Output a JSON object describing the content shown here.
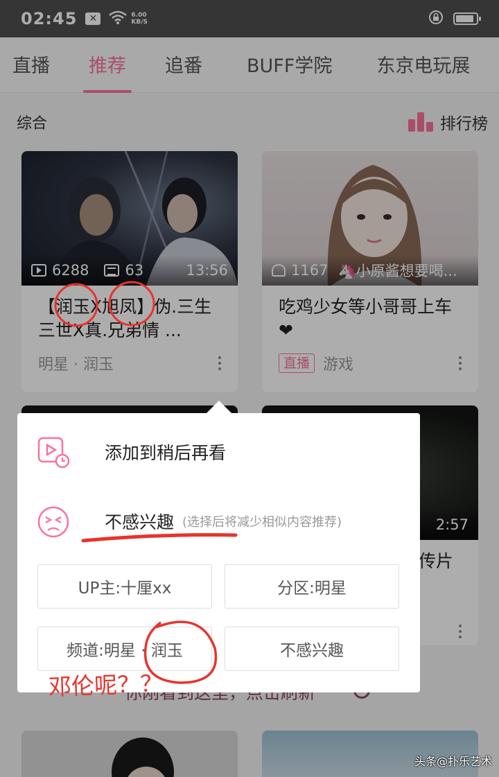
{
  "status_bar": {
    "time": "02:45",
    "notif_badge": "✕",
    "net_speed_value": "6.00",
    "net_speed_unit": "KB/S",
    "battery_level": 0.9
  },
  "tabs": [
    {
      "label": "直播",
      "active": false
    },
    {
      "label": "推荐",
      "active": true
    },
    {
      "label": "追番",
      "active": false
    },
    {
      "label": "BUFF学院",
      "active": false
    },
    {
      "label": "东京电玩展",
      "active": false
    }
  ],
  "section": {
    "title": "综合",
    "ranking_label": "排行榜"
  },
  "cards": [
    {
      "title": "【润玉X旭凤】伪.三生三世X真.兄弟情 ...",
      "views": "6288",
      "danmaku": "63",
      "duration": "13:56",
      "meta": "明星 · 润玉"
    },
    {
      "title": "吃鸡少女等小哥哥上车❤",
      "online": "1167",
      "uploader": "🦄小原酱想要喝...",
      "badge": "直播",
      "meta": "游戏"
    },
    {
      "duration": "2:57",
      "title_partial": "传片"
    }
  ],
  "background_notice": "你刚看到这里，点击刷新",
  "popup": {
    "watch_later": "添加到稍后再看",
    "not_interested": "不感兴趣",
    "not_interested_hint": "(选择后将减少相似内容推荐)",
    "chips": [
      "UP主:十厘xx",
      "分区:明星",
      "频道:明星 · 润玉",
      "不感兴趣"
    ]
  },
  "annotation": {
    "text": "邓伦呢？？",
    "color": "#e8332d"
  },
  "watermark": "头条@扑乐艺术",
  "colors": {
    "accent": "#fb7299",
    "status_bar": "#4e4e4e"
  },
  "icons": [
    "play-clock-icon",
    "sad-face-icon",
    "ranking-icon",
    "wifi-icon",
    "lock-icon",
    "battery-icon"
  ]
}
